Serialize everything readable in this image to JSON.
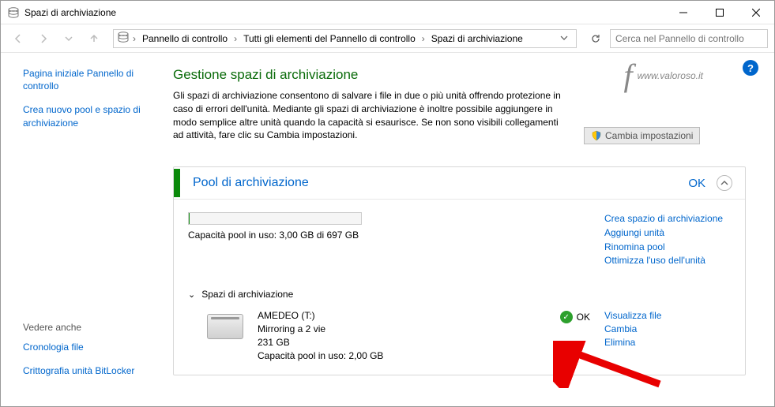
{
  "window": {
    "title": "Spazi di archiviazione"
  },
  "breadcrumb": {
    "items": [
      "Pannello di controllo",
      "Tutti gli elementi del Pannello di controllo",
      "Spazi di archiviazione"
    ]
  },
  "search": {
    "placeholder": "Cerca nel Pannello di controllo"
  },
  "sidebar": {
    "links": [
      "Pagina iniziale Pannello di controllo",
      "Crea nuovo pool e spazio di archiviazione"
    ],
    "seeAlsoHeader": "Vedere anche",
    "seeAlso": [
      "Cronologia file",
      "Crittografia unità BitLocker"
    ]
  },
  "watermark": "www.valoroso.it",
  "page": {
    "title": "Gestione spazi di archiviazione",
    "intro": "Gli spazi di archiviazione consentono di salvare i file in due o più unità offrendo protezione in caso di errori dell'unità. Mediante gli spazi di archiviazione è inoltre possibile aggiungere in modo semplice altre unità quando la capacità si esaurisce. Se non sono visibili collegamenti ad attività, fare clic su Cambia impostazioni.",
    "changeBtn": "Cambia impostazioni"
  },
  "pool": {
    "title": "Pool di archiviazione",
    "status": "OK",
    "capacity": "Capacità pool in uso: 3,00 GB di 697 GB",
    "actions": [
      "Crea spazio di archiviazione",
      "Aggiungi unità",
      "Rinomina pool",
      "Ottimizza l'uso dell'unità"
    ],
    "spacesHeader": "Spazi di archiviazione",
    "space": {
      "name": "AMEDEO (T:)",
      "type": "Mirroring a 2 vie",
      "size": "231 GB",
      "usage": "Capacità pool in uso: 2,00 GB",
      "status": "OK",
      "links": [
        "Visualizza file",
        "Cambia",
        "Elimina"
      ]
    }
  }
}
